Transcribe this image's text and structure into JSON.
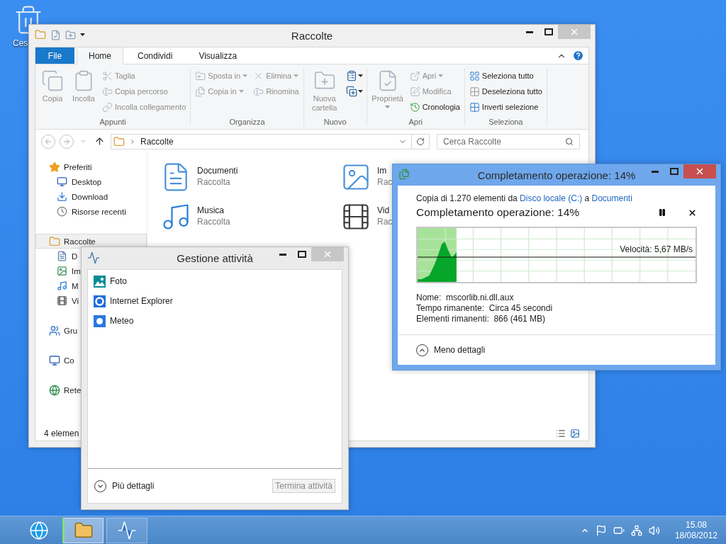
{
  "desktop": {
    "icons": [
      {
        "label": "Ces"
      }
    ]
  },
  "explorer": {
    "title": "Raccolte",
    "tabs": [
      {
        "label": "File",
        "kind": "file",
        "selected": false
      },
      {
        "label": "Home",
        "kind": "tab",
        "selected": true
      },
      {
        "label": "Condividi",
        "kind": "tab",
        "selected": false
      },
      {
        "label": "Visualizza",
        "kind": "tab",
        "selected": false
      }
    ],
    "ribbon_groups": [
      {
        "label": "Appunti",
        "columns": [
          {
            "kind": "large",
            "items": [
              {
                "label": "Copia",
                "disabled": true,
                "dropdown": false
              }
            ]
          },
          {
            "kind": "large",
            "items": [
              {
                "label": "Incolla",
                "disabled": true,
                "dropdown": false
              }
            ]
          },
          {
            "kind": "small",
            "items": [
              {
                "label": "Taglia",
                "disabled": true,
                "dropdown": false
              },
              {
                "label": "Copia percorso",
                "disabled": true,
                "dropdown": false
              },
              {
                "label": "Incolla collegamento",
                "disabled": true,
                "dropdown": false
              }
            ]
          }
        ]
      },
      {
        "label": "Organizza",
        "columns": [
          {
            "kind": "small",
            "items": [
              {
                "label": "Sposta in",
                "disabled": true,
                "dropdown": true
              },
              {
                "label": "Copia in",
                "disabled": true,
                "dropdown": true
              }
            ]
          },
          {
            "kind": "small",
            "items": [
              {
                "label": "Elimina",
                "disabled": true,
                "dropdown": true
              },
              {
                "label": "Rinomina",
                "disabled": true,
                "dropdown": false
              }
            ]
          }
        ]
      },
      {
        "label": "Nuovo",
        "columns": [
          {
            "kind": "large",
            "items": [
              {
                "label": "Nuova cartella",
                "disabled": true,
                "dropdown": false
              }
            ]
          }
        ]
      },
      {
        "label": "Apri",
        "columns": [
          {
            "kind": "large",
            "items": [
              {
                "label": "Proprietà",
                "disabled": true,
                "dropdown": true
              }
            ]
          },
          {
            "kind": "small",
            "items": [
              {
                "label": "Apri",
                "disabled": true,
                "dropdown": true
              },
              {
                "label": "Modifica",
                "disabled": true,
                "dropdown": false
              },
              {
                "label": "Cronologia",
                "disabled": false,
                "dropdown": false
              }
            ]
          }
        ]
      },
      {
        "label": "Seleziona",
        "columns": [
          {
            "kind": "small",
            "items": [
              {
                "label": "Seleziona tutto",
                "disabled": false,
                "dropdown": false
              },
              {
                "label": "Deseleziona tutto",
                "disabled": false,
                "dropdown": false
              },
              {
                "label": "Inverti selezione",
                "disabled": false,
                "dropdown": false
              }
            ]
          }
        ]
      }
    ],
    "address": "Raccolte",
    "search": {
      "placeholder": "Cerca Raccolte"
    },
    "nav": [
      {
        "label": "Preferiti",
        "selected": false,
        "children": [
          {
            "label": "Desktop",
            "selected": false
          },
          {
            "label": "Download",
            "selected": false
          },
          {
            "label": "Risorse recenti",
            "selected": false
          }
        ]
      },
      {
        "label": "Raccolte",
        "selected": true,
        "children": [
          {
            "label": "D",
            "selected": false
          },
          {
            "label": "Im",
            "selected": false
          },
          {
            "label": "M",
            "selected": false
          },
          {
            "label": "Vi",
            "selected": false
          }
        ]
      },
      {
        "label": "Gru",
        "selected": false
      },
      {
        "label": "Co",
        "selected": false
      },
      {
        "label": "Rete",
        "selected": false
      }
    ],
    "items": [
      {
        "name": "Documenti",
        "type": "Raccolta"
      },
      {
        "name": "Im",
        "type": "Rac"
      },
      {
        "name": "Musica",
        "type": "Raccolta"
      },
      {
        "name": "Vid",
        "type": "Rac"
      }
    ],
    "status": "4 elemen"
  },
  "task_manager": {
    "title": "Gestione attività",
    "apps": [
      {
        "label": "Foto"
      },
      {
        "label": "Internet Explorer"
      },
      {
        "label": "Meteo"
      }
    ],
    "details_toggle": "Più dettagli",
    "end_task": {
      "label": "Termina attività",
      "disabled": true
    }
  },
  "copy_dialog": {
    "title": "Completamento operazione: 14%",
    "summary": {
      "text_1": "Copia di 1.270 elementi da",
      "source": "Disco locale (C:)",
      "text_2": "a",
      "destination": "Documenti"
    },
    "heading": "Completamento operazione: 14%",
    "progress": {
      "level": 0.14
    },
    "speed": "Velocità: 5,67 MB/s",
    "details": [
      {
        "label": "Nome:",
        "value": "mscorlib.ni.dll.aux"
      },
      {
        "label": "Tempo rimanente:",
        "value": "Circa 45 secondi"
      },
      {
        "label": "Elementi rimanenti:",
        "value": "866 (461 MB)"
      }
    ],
    "details_toggle": "Meno dettagli"
  },
  "taskbar": {
    "apps": [
      {
        "running": false,
        "selected": false
      },
      {
        "running": true,
        "selected": true
      },
      {
        "running": true,
        "selected": false
      }
    ],
    "clock": {
      "time": "15.08",
      "date": "18/08/2012"
    }
  }
}
